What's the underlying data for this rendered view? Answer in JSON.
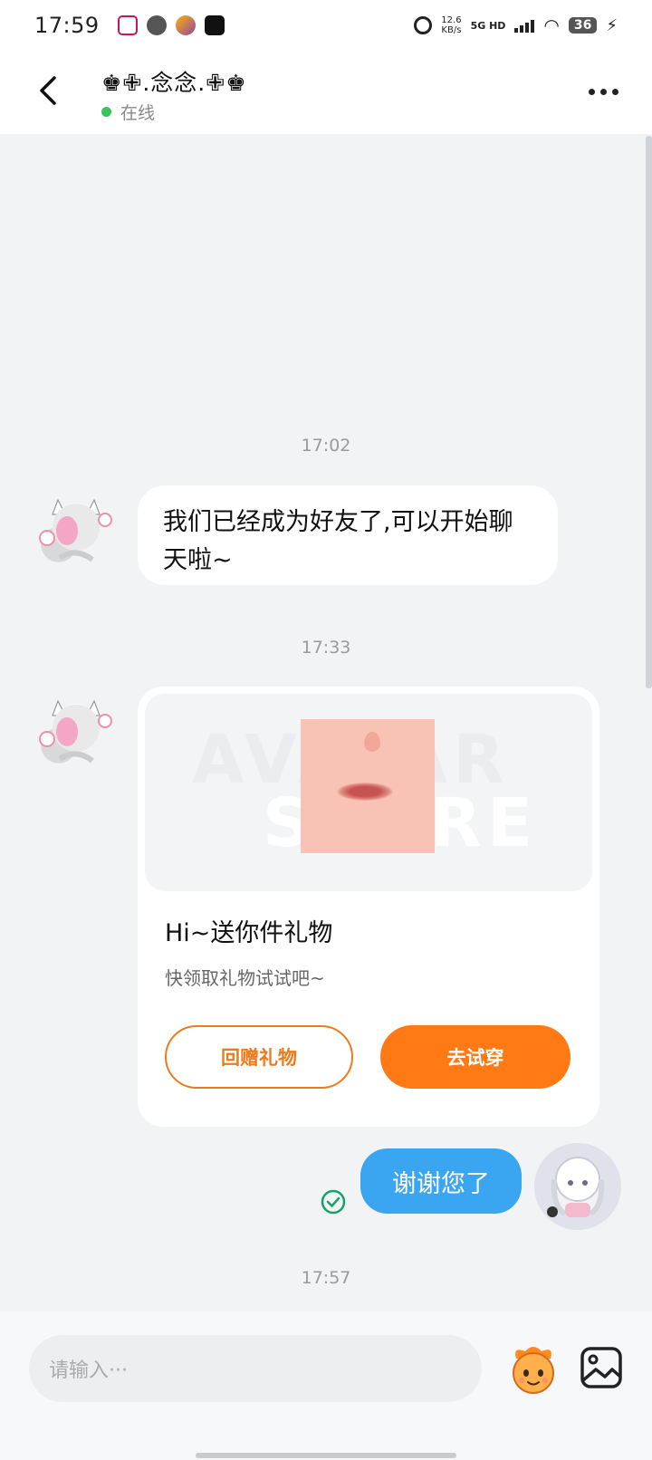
{
  "status_bar": {
    "time": "17:59",
    "net_speed_value": "12.6",
    "net_speed_unit": "KB/s",
    "network": "5G HD",
    "battery": "36"
  },
  "header": {
    "contact_name": "♚✙.念念.✙♚",
    "presence": "在线"
  },
  "messages": {
    "ts1": "17:02",
    "msg1": "我们已经成为好友了,可以开始聊天啦~",
    "ts2": "17:33",
    "gift": {
      "watermark_line1": "AVATAR",
      "watermark_line2": "STORE",
      "title": "Hi~送你件礼物",
      "subtitle": "快领取礼物试试吧~",
      "return_gift_label": "回赠礼物",
      "try_on_label": "去试穿"
    },
    "msg2": "谢谢您了",
    "ts3": "17:57"
  },
  "input": {
    "placeholder": "请输入···"
  },
  "colors": {
    "accent_orange": "#ff7a14",
    "outgoing_bubble": "#3aa5f0",
    "online_green": "#3cc45a",
    "read_check": "#14a36a"
  }
}
